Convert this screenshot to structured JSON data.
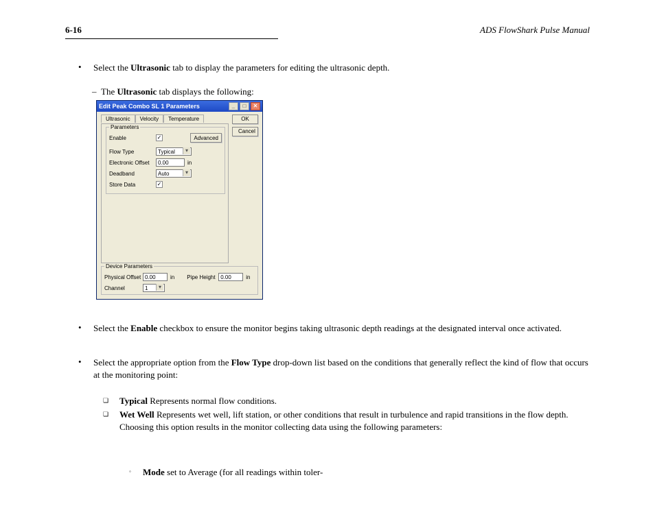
{
  "page": {
    "number": "6-16",
    "header_title": "ADS FlowShark Pulse Manual"
  },
  "bullets": {
    "b1": "Select the Ultrasonic tab to display the parameters for editing the ultrasonic depth.",
    "sub1": "The Ultrasonic tab displays the following:",
    "b2": "Select the Enable checkbox to ensure the monitor begins taking ultrasonic depth readings at the designated interval once activated.",
    "b3": "Select the appropriate option from the Flow Type drop-down list based on the conditions that generally reflect the kind of flow that occurs at the monitoring point:",
    "sq1_label": "Typical",
    "sq1_text": "  Represents normal flow conditions.",
    "sq2_label": "Wet Well",
    "sq2_text": "  Represents wet well, lift station, or other conditions that result in turbulence and rapid transitions in the flow depth.  Choosing this option results in the monitor collecting data using the following parameters:",
    "ring1_label": "Mode",
    "ring1_text": " set to Average (for all readings within toler-"
  },
  "dialog": {
    "title": "Edit Peak Combo SL 1 Parameters",
    "tabs": {
      "ultrasonic": "Ultrasonic",
      "velocity": "Velocity",
      "temperature": "Temperature"
    },
    "params": {
      "legend": "Parameters",
      "enable_label": "Enable",
      "enable_checked": "✓",
      "flowtype_label": "Flow Type",
      "flowtype_value": "Typical",
      "eo_label": "Electronic Offset",
      "eo_value": "0.00",
      "eo_unit": "in",
      "deadband_label": "Deadband",
      "deadband_value": "Auto",
      "storedata_label": "Store Data",
      "storedata_checked": "✓",
      "advanced": "Advanced"
    },
    "device": {
      "legend": "Device Parameters",
      "po_label": "Physical Offset",
      "po_value": "0.00",
      "po_unit": "in",
      "ph_label": "Pipe Height",
      "ph_value": "0.00",
      "ph_unit": "in",
      "channel_label": "Channel",
      "channel_value": "1"
    },
    "buttons": {
      "ok": "OK",
      "cancel": "Cancel"
    }
  }
}
